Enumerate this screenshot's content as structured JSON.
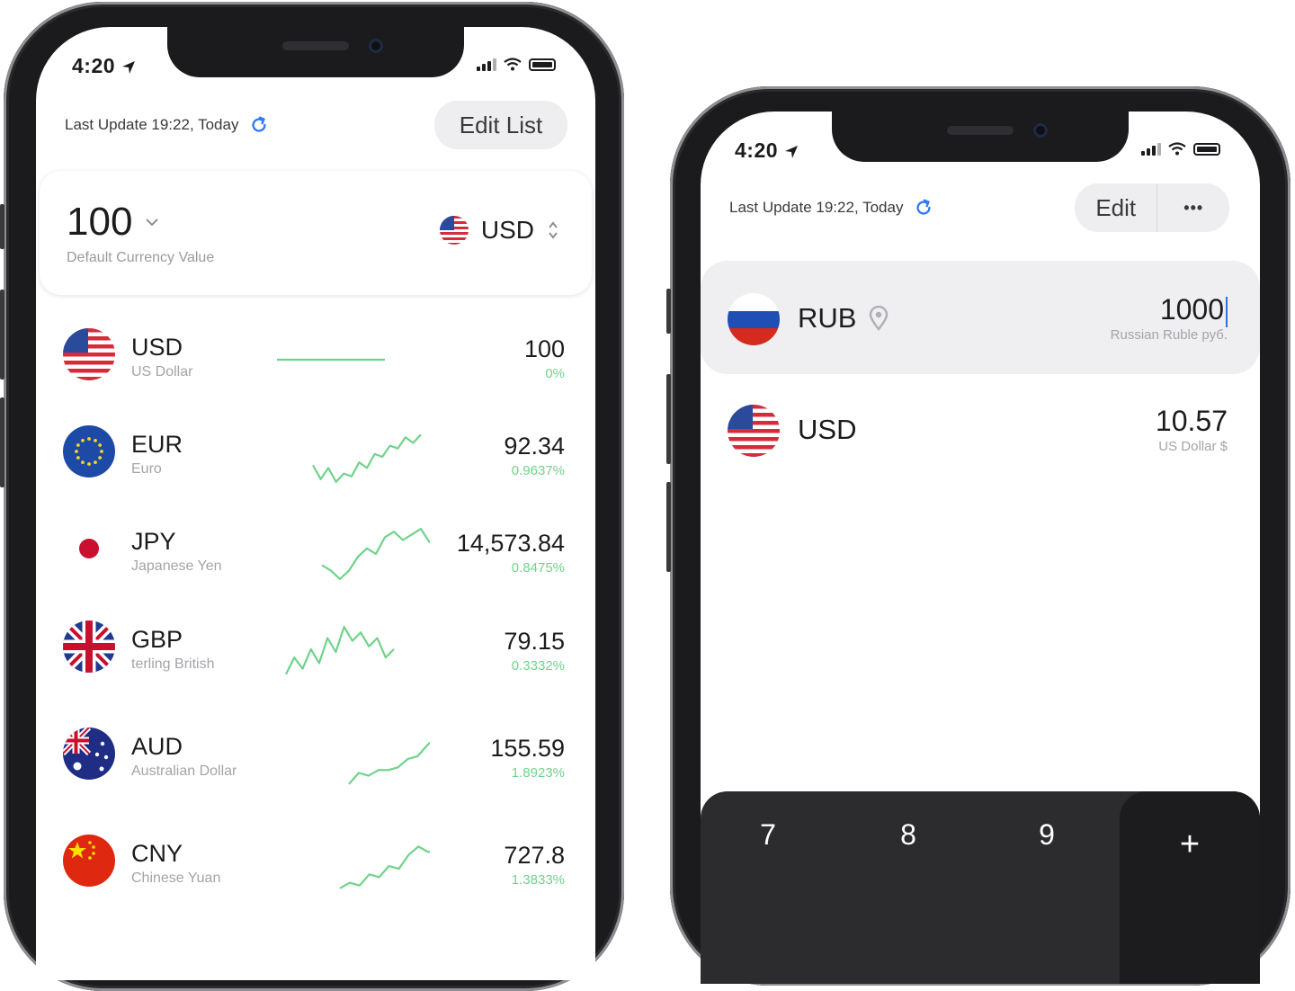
{
  "left_phone": {
    "status_time": "4:20",
    "last_update": "Last Update 19:22, Today",
    "edit_button": "Edit List",
    "default_card": {
      "value": "100",
      "caption": "Default Currency Value",
      "currency": "USD"
    },
    "currencies": [
      {
        "code": "USD",
        "name": "US Dollar",
        "value": "100",
        "change": "0%",
        "sparkline": [
          0.5,
          0.5,
          0.5,
          0.5,
          0.5,
          0.5,
          0.5,
          0.5
        ]
      },
      {
        "code": "EUR",
        "name": "Euro",
        "value": "92.34",
        "change": "0.9637%",
        "sparkline": [
          0.35,
          0.1,
          0.3,
          0.05,
          0.2,
          0.15,
          0.4,
          0.3,
          0.55,
          0.5,
          0.7,
          0.65,
          0.85,
          0.75,
          0.9
        ]
      },
      {
        "code": "JPY",
        "name": "Japanese Yen",
        "value": "14,573.84",
        "change": "0.8475%",
        "sparkline": [
          0.3,
          0.2,
          0.05,
          0.2,
          0.45,
          0.6,
          0.5,
          0.8,
          0.9,
          0.75,
          0.85,
          0.95,
          0.7
        ]
      },
      {
        "code": "GBP",
        "name": "terling   British",
        "value": "79.15",
        "change": "0.3332%",
        "sparkline": [
          0.1,
          0.4,
          0.2,
          0.55,
          0.3,
          0.75,
          0.5,
          0.95,
          0.7,
          0.85,
          0.6,
          0.75,
          0.4,
          0.55
        ]
      },
      {
        "code": "AUD",
        "name": "Australian Dollar",
        "value": "155.59",
        "change": "1.8923%",
        "sparkline": [
          0.05,
          0.25,
          0.2,
          0.3,
          0.3,
          0.35,
          0.5,
          0.55,
          0.75,
          0.9,
          0.85,
          0.6
        ]
      },
      {
        "code": "CNY",
        "name": "Chinese Yuan",
        "value": "727.8",
        "change": "1.3833%",
        "sparkline": [
          0.1,
          0.2,
          0.15,
          0.35,
          0.3,
          0.5,
          0.45,
          0.7,
          0.85,
          0.75,
          0.8,
          0.78
        ]
      }
    ]
  },
  "right_phone": {
    "status_time": "4:20",
    "last_update": "Last Update 19:22, Today",
    "edit_button": "Edit",
    "more_button": "•••",
    "rows": [
      {
        "code": "RUB",
        "amount": "1000",
        "desc": "Russian Ruble руб."
      },
      {
        "code": "USD",
        "amount": "10.57",
        "desc": "US Dollar $"
      }
    ],
    "keypad": {
      "k7": "7",
      "k8": "8",
      "k9": "9",
      "plus": "+"
    }
  },
  "colors": {
    "accent": "#2f7cf6",
    "positive": "#6fd38a",
    "keypad": "#2c2c2e"
  },
  "icons": [
    "location-arrow-icon",
    "signal-icon",
    "wifi-icon",
    "battery-icon",
    "refresh-icon",
    "chevron-down-icon",
    "sort-arrows-icon",
    "location-pin-icon"
  ]
}
